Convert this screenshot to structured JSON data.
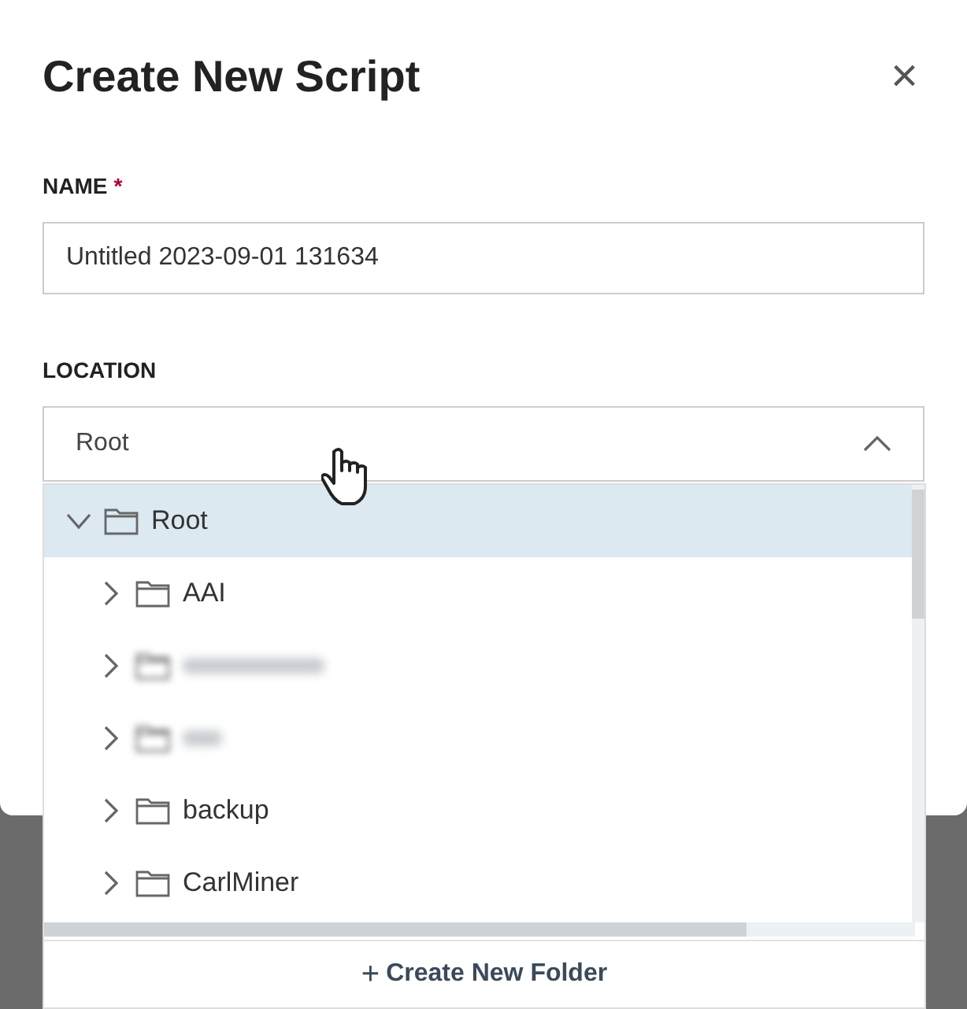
{
  "dialog": {
    "title": "Create New Script",
    "close": "×"
  },
  "name_field": {
    "label": "NAME",
    "required_mark": "*",
    "value": "Untitled 2023-09-01 131634"
  },
  "location_field": {
    "label": "LOCATION",
    "value": "Root",
    "expanded": true
  },
  "tree": [
    {
      "label": "Root",
      "expanded": true,
      "selected": true,
      "children": [
        {
          "label": "AAI",
          "expanded": false,
          "selected": false
        },
        {
          "blurred": true,
          "expanded": false,
          "selected": false
        },
        {
          "blurred": true,
          "expanded": false,
          "selected": false
        },
        {
          "label": "backup",
          "expanded": false,
          "selected": false
        },
        {
          "label": "CarlMiner",
          "expanded": false,
          "selected": false
        }
      ]
    }
  ],
  "create_folder": {
    "icon": "+",
    "label": "Create New Folder"
  }
}
